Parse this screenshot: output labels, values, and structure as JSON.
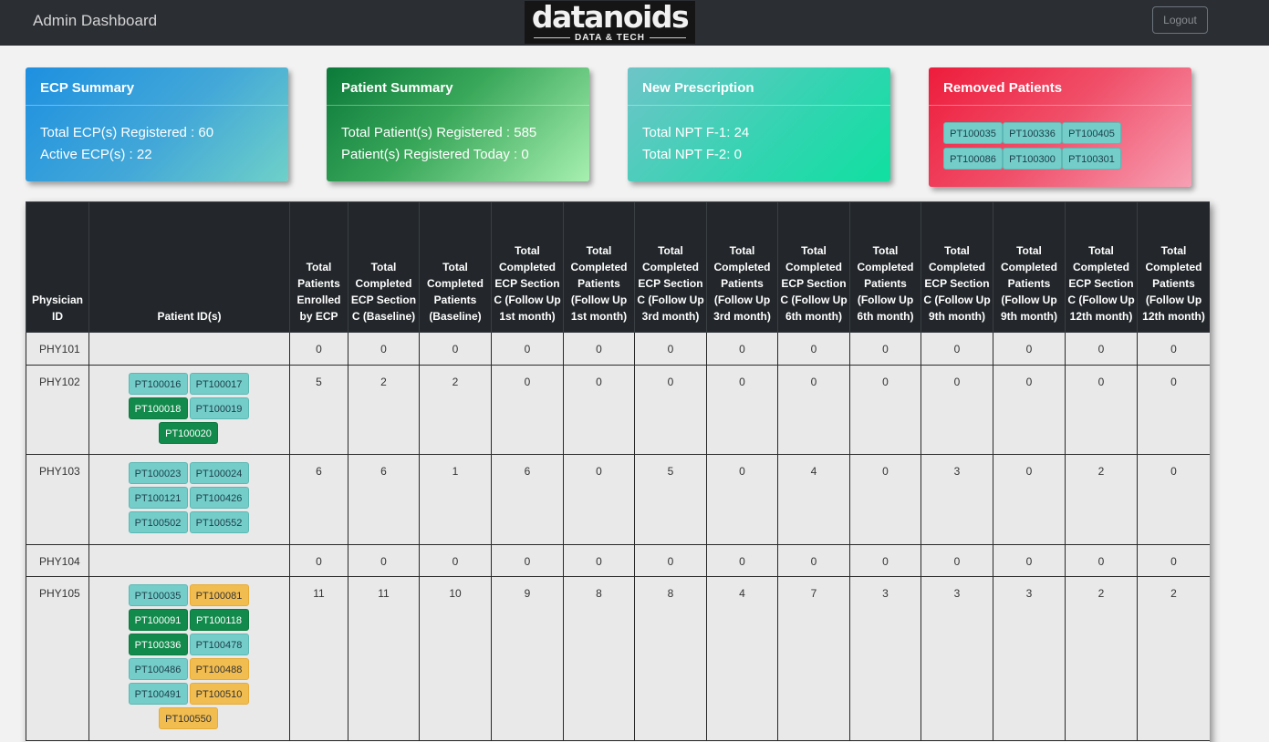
{
  "navbar": {
    "brand": "Admin Dashboard",
    "logo_word": "datanoids",
    "logo_sub": "DATA & TECH",
    "logout_label": "Logout"
  },
  "cards": {
    "ecp": {
      "title": "ECP Summary",
      "line1": "Total ECP(s) Registered : 60",
      "line2": "Active ECP(s) : 22"
    },
    "patient": {
      "title": "Patient Summary",
      "line1": "Total Patient(s) Registered : 585",
      "line2": "Patient(s) Registered Today : 0"
    },
    "prescription": {
      "title": "New Prescription",
      "line1": "Total NPT F-1: 24",
      "line2": "Total NPT F-2: 0"
    },
    "removed": {
      "title": "Removed Patients",
      "ids": [
        "PT100035",
        "PT100336",
        "PT100405",
        "PT100086",
        "PT100300",
        "PT100301"
      ]
    }
  },
  "table": {
    "headers": [
      "Physician ID",
      "Patient ID(s)",
      "Total Patients Enrolled by ECP",
      "Total Completed ECP Section C (Baseline)",
      "Total Completed Patients (Baseline)",
      "Total Completed ECP Section C (Follow Up 1st month)",
      "Total Completed Patients (Follow Up 1st month)",
      "Total Completed ECP Section C (Follow Up 3rd month)",
      "Total Completed Patients (Follow Up 3rd month)",
      "Total Completed ECP Section C (Follow Up 6th month)",
      "Total Completed Patients (Follow Up 6th month)",
      "Total Completed ECP Section C (Follow Up 9th month)",
      "Total Completed Patients (Follow Up 9th month)",
      "Total Completed ECP Section C (Follow Up 12th month)",
      "Total Completed Patients (Follow Up 12th month)"
    ],
    "rows": [
      {
        "phy": "PHY101",
        "pids": [],
        "vals": [
          "0",
          "0",
          "0",
          "0",
          "0",
          "0",
          "0",
          "0",
          "0",
          "0",
          "0",
          "0",
          "0"
        ]
      },
      {
        "phy": "PHY102",
        "pids": [
          {
            "id": "PT100016",
            "color": "teal"
          },
          {
            "id": "PT100017",
            "color": "teal"
          },
          {
            "id": "PT100018",
            "color": "green"
          },
          {
            "id": "PT100019",
            "color": "teal"
          },
          {
            "id": "PT100020",
            "color": "green"
          }
        ],
        "vals": [
          "5",
          "2",
          "2",
          "0",
          "0",
          "0",
          "0",
          "0",
          "0",
          "0",
          "0",
          "0",
          "0"
        ]
      },
      {
        "phy": "PHY103",
        "pids": [
          {
            "id": "PT100023",
            "color": "teal"
          },
          {
            "id": "PT100024",
            "color": "teal"
          },
          {
            "id": "PT100121",
            "color": "teal"
          },
          {
            "id": "PT100426",
            "color": "teal"
          },
          {
            "id": "PT100502",
            "color": "teal"
          },
          {
            "id": "PT100552",
            "color": "teal"
          }
        ],
        "vals": [
          "6",
          "6",
          "1",
          "6",
          "0",
          "5",
          "0",
          "4",
          "0",
          "3",
          "0",
          "2",
          "0"
        ]
      },
      {
        "phy": "PHY104",
        "pids": [],
        "vals": [
          "0",
          "0",
          "0",
          "0",
          "0",
          "0",
          "0",
          "0",
          "0",
          "0",
          "0",
          "0",
          "0"
        ]
      },
      {
        "phy": "PHY105",
        "pids": [
          {
            "id": "PT100035",
            "color": "teal"
          },
          {
            "id": "PT100081",
            "color": "yellow"
          },
          {
            "id": "PT100091",
            "color": "green"
          },
          {
            "id": "PT100118",
            "color": "green"
          },
          {
            "id": "PT100336",
            "color": "green"
          },
          {
            "id": "PT100478",
            "color": "teal"
          },
          {
            "id": "PT100486",
            "color": "teal"
          },
          {
            "id": "PT100488",
            "color": "yellow"
          },
          {
            "id": "PT100491",
            "color": "teal"
          },
          {
            "id": "PT100510",
            "color": "yellow"
          },
          {
            "id": "PT100550",
            "color": "yellow"
          }
        ],
        "vals": [
          "11",
          "11",
          "10",
          "9",
          "8",
          "8",
          "4",
          "7",
          "3",
          "3",
          "3",
          "2",
          "2"
        ]
      }
    ]
  },
  "colors": {
    "navbar": "#2b2e33",
    "table_header": "#23272b",
    "teal_chip": "#74cdc9",
    "green_chip": "#128a4c",
    "yellow_chip": "#f2bd50"
  }
}
